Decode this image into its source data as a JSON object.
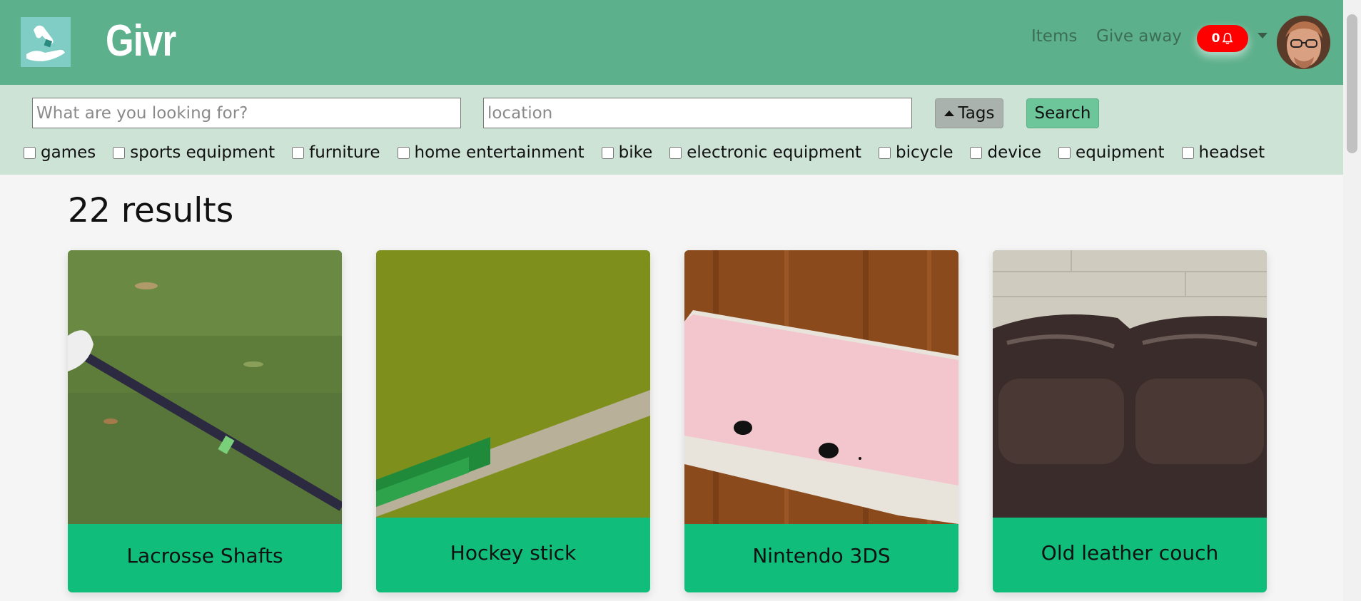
{
  "header": {
    "brand": "Givr",
    "nav": {
      "items": "Items",
      "give_away": "Give away"
    },
    "notifications": {
      "count": "0"
    }
  },
  "search": {
    "what_placeholder": "What are you looking for?",
    "location_placeholder": "location",
    "tags_label": "Tags",
    "search_label": "Search",
    "tags": [
      "games",
      "sports equipment",
      "furniture",
      "home entertainment",
      "bike",
      "electronic equipment",
      "bicycle",
      "device",
      "equipment",
      "headset"
    ]
  },
  "results": {
    "count_label": "22 results",
    "cards": [
      {
        "title": "Lacrosse Shafts"
      },
      {
        "title": "Hockey stick"
      },
      {
        "title": "Nintendo 3DS"
      },
      {
        "title": "Old leather couch"
      }
    ]
  },
  "colors": {
    "header_bg": "#5db08c",
    "searchbar_bg": "#cde3d6",
    "card_bg": "#11bd7b",
    "notif_bg": "#ff0000"
  }
}
